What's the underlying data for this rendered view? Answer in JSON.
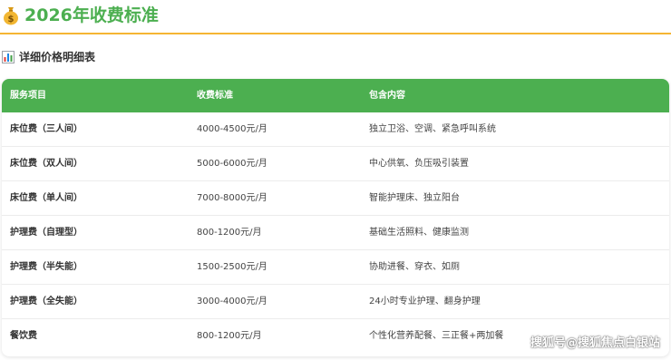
{
  "header": {
    "title": "2026年收费标准",
    "icon": "money-bag-icon"
  },
  "section": {
    "title": "详细价格明细表",
    "icon": "bar-chart-icon"
  },
  "table": {
    "columns": [
      "服务项目",
      "收费标准",
      "包含内容"
    ],
    "rows": [
      [
        "床位费（三人间）",
        "4000-4500元/月",
        "独立卫浴、空调、紧急呼叫系统"
      ],
      [
        "床位费（双人间）",
        "5000-6000元/月",
        "中心供氧、负压吸引装置"
      ],
      [
        "床位费（单人间）",
        "7000-8000元/月",
        "智能护理床、独立阳台"
      ],
      [
        "护理费（自理型）",
        "800-1200元/月",
        "基础生活照料、健康监测"
      ],
      [
        "护理费（半失能）",
        "1500-2500元/月",
        "协助进餐、穿衣、如厕"
      ],
      [
        "护理费（全失能）",
        "3000-4000元/月",
        "24小时专业护理、翻身护理"
      ],
      [
        "餐饮费",
        "800-1200元/月",
        "个性化营养配餐、三正餐+两加餐"
      ]
    ]
  },
  "watermark": "搜狐号@搜狐焦点白银站",
  "colors": {
    "accent": "#4caf50",
    "divider": "#f5b533"
  }
}
